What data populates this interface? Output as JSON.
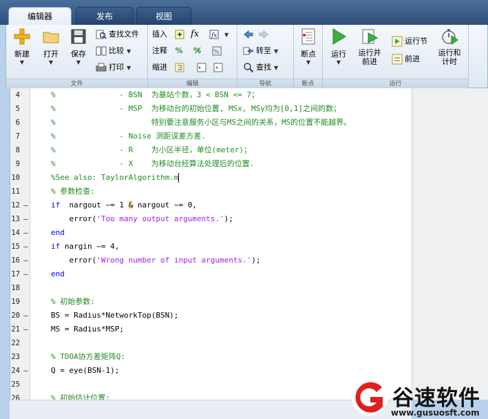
{
  "tabs": [
    {
      "label": "编辑器",
      "active": true
    },
    {
      "label": "发布",
      "active": false
    },
    {
      "label": "视图",
      "active": false
    }
  ],
  "ribbon": {
    "file": {
      "group_label": "文件",
      "new_label": "新建",
      "open_label": "打开",
      "save_label": "保存",
      "find_files_label": "查找文件",
      "compare_label": "比较",
      "print_label": "打印"
    },
    "edit": {
      "group_label": "编辑",
      "insert_label": "插入",
      "comment_label": "注释",
      "indent_label": "缩进",
      "fx_label": "fx"
    },
    "navigate": {
      "group_label": "导航",
      "goto_label": "转至",
      "find_label": "查找"
    },
    "breakpoints": {
      "group_label": "断点",
      "breakpoints_label": "断点"
    },
    "run": {
      "group_label": "运行",
      "run_label": "运行",
      "run_advance_label": "运行并\n前进",
      "run_section_label": "运行节",
      "advance_label": "前进",
      "run_time_label": "运行和\n计时"
    }
  },
  "editor": {
    "lines": [
      {
        "num": "4",
        "mark": "",
        "parts": [
          {
            "t": "%              - BSN  为基站个数，3 < BSN <= 7；",
            "c": "comment"
          }
        ]
      },
      {
        "num": "5",
        "mark": "",
        "parts": [
          {
            "t": "%              - MSP  为移动台的初始位置, MSx, MSy均为[0,1]之间的数；",
            "c": "comment"
          }
        ]
      },
      {
        "num": "6",
        "mark": "",
        "parts": [
          {
            "t": "%                     特别要注意服务小区与MS之间的关系，MS的位置不能越界。",
            "c": "comment"
          }
        ]
      },
      {
        "num": "7",
        "mark": "",
        "parts": [
          {
            "t": "%              - Noise 测距误差方差.",
            "c": "comment"
          }
        ]
      },
      {
        "num": "8",
        "mark": "",
        "parts": [
          {
            "t": "%              - R    为小区半径，单位(meter)；",
            "c": "comment"
          }
        ]
      },
      {
        "num": "9",
        "mark": "",
        "parts": [
          {
            "t": "%              - X    为移动台经算法处理后的位置.",
            "c": "comment"
          }
        ]
      },
      {
        "num": "10",
        "mark": "",
        "parts": [
          {
            "t": "%See also: TaylorAlgorithm.m",
            "c": "comment"
          }
        ],
        "caret": true
      },
      {
        "num": "11",
        "mark": "",
        "parts": [
          {
            "t": "% 参数检查:",
            "c": "comment"
          }
        ]
      },
      {
        "num": "12",
        "mark": "–",
        "parts": [
          {
            "t": "if",
            "c": "kw"
          },
          {
            "t": "  nargout ~= 1 ",
            "c": "plain"
          },
          {
            "t": "&",
            "c": "amp"
          },
          {
            "t": " nargout ~= 0,",
            "c": "plain"
          }
        ]
      },
      {
        "num": "13",
        "mark": "–",
        "parts": [
          {
            "t": "    error(",
            "c": "plain"
          },
          {
            "t": "'Too many output arguments.'",
            "c": "str"
          },
          {
            "t": ");",
            "c": "plain"
          }
        ]
      },
      {
        "num": "14",
        "mark": "–",
        "parts": [
          {
            "t": "end",
            "c": "kw"
          }
        ]
      },
      {
        "num": "15",
        "mark": "–",
        "parts": [
          {
            "t": "if",
            "c": "kw"
          },
          {
            "t": " nargin ~= 4,",
            "c": "plain"
          }
        ]
      },
      {
        "num": "16",
        "mark": "–",
        "parts": [
          {
            "t": "    error(",
            "c": "plain"
          },
          {
            "t": "'Wrong number of input arguments.'",
            "c": "str"
          },
          {
            "t": ");",
            "c": "plain"
          }
        ]
      },
      {
        "num": "17",
        "mark": "–",
        "parts": [
          {
            "t": "end",
            "c": "kw"
          }
        ]
      },
      {
        "num": "18",
        "mark": "",
        "parts": []
      },
      {
        "num": "19",
        "mark": "",
        "parts": [
          {
            "t": "% 初始参数:",
            "c": "comment"
          }
        ]
      },
      {
        "num": "20",
        "mark": "–",
        "parts": [
          {
            "t": "BS = Radius*NetworkTop(BSN);",
            "c": "plain"
          }
        ]
      },
      {
        "num": "21",
        "mark": "–",
        "parts": [
          {
            "t": "MS = Radius*MSP;",
            "c": "plain"
          }
        ]
      },
      {
        "num": "22",
        "mark": "",
        "parts": []
      },
      {
        "num": "23",
        "mark": "",
        "parts": [
          {
            "t": "% TDOA协方差矩阵Q:",
            "c": "comment"
          }
        ]
      },
      {
        "num": "24",
        "mark": "–",
        "parts": [
          {
            "t": "Q = eye(BSN-1);",
            "c": "plain"
          }
        ]
      },
      {
        "num": "25",
        "mark": "",
        "parts": []
      },
      {
        "num": "26",
        "mark": "",
        "parts": [
          {
            "t": "% 初始估计位置:",
            "c": "comment"
          }
        ]
      }
    ]
  },
  "watermark": {
    "title": "谷速软件",
    "url": "www.gusuosft.com"
  },
  "colors": {
    "comment": "#228b22",
    "keyword": "#0000ff",
    "string": "#a020f0",
    "tab_bar": "#2d4e79",
    "watermark_red": "#e02020"
  }
}
